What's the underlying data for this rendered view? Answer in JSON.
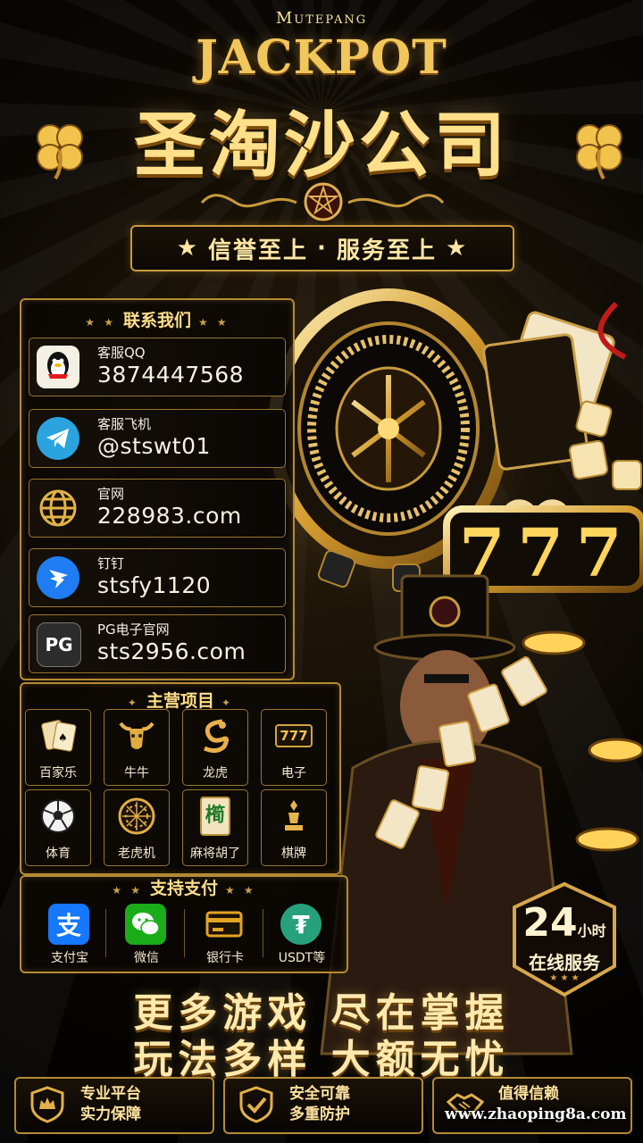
{
  "header": {
    "brand_small": "Mutepang",
    "jackpot": "JACKPOT",
    "title": "圣淘沙公司",
    "slogan_left": "信誉至上",
    "slogan_dot": "·",
    "slogan_right": "服务至上"
  },
  "contact": {
    "heading": "联系我们",
    "items": [
      {
        "label": "客服QQ",
        "value": "3874447568",
        "icon": "qq-penguin-icon"
      },
      {
        "label": "客服飞机",
        "value": "@stswt01",
        "icon": "telegram-icon"
      },
      {
        "label": "官网",
        "value": "228983.com",
        "icon": "globe-icon"
      },
      {
        "label": "钉钉",
        "value": "stsfy1120",
        "icon": "dingtalk-icon"
      },
      {
        "label": "PG电子官网",
        "value": "sts2956.com",
        "icon": "pg-logo-icon",
        "icon_text": "PG"
      }
    ]
  },
  "games": {
    "heading": "主营项目",
    "items": [
      {
        "label": "百家乐",
        "icon": "playing-cards-icon"
      },
      {
        "label": "牛牛",
        "icon": "bull-head-icon"
      },
      {
        "label": "龙虎",
        "icon": "dragon-icon"
      },
      {
        "label": "电子",
        "icon": "slot-777-icon",
        "icon_text": "777"
      },
      {
        "label": "体育",
        "icon": "soccer-ball-icon"
      },
      {
        "label": "老虎机",
        "icon": "roulette-wheel-icon"
      },
      {
        "label": "麻将胡了",
        "icon": "mahjong-tile-icon",
        "icon_text": "橁"
      },
      {
        "label": "棋牌",
        "icon": "chess-piece-icon"
      }
    ]
  },
  "payment": {
    "heading": "支持支付",
    "items": [
      {
        "label": "支付宝",
        "icon": "alipay-icon",
        "icon_text": "支",
        "color": "#1677ff"
      },
      {
        "label": "微信",
        "icon": "wechat-icon",
        "color": "#1aad19"
      },
      {
        "label": "银行卡",
        "icon": "bank-card-icon",
        "color": "#e2a423"
      },
      {
        "label": "USDT等",
        "icon": "tether-icon",
        "icon_text": "₮",
        "color": "#26a17b"
      }
    ]
  },
  "service_badge": {
    "big": "24",
    "small": "小时",
    "line2": "在线服务",
    "stars": "★ ★ ★"
  },
  "headline": {
    "line1": "更多游戏 尽在掌握",
    "line2": "玩法多样 大额无忧"
  },
  "features": [
    {
      "line1": "专业平台",
      "line2": "实力保障",
      "icon": "crown-shield-icon"
    },
    {
      "line1": "安全可靠",
      "line2": "多重防护",
      "icon": "check-shield-icon"
    },
    {
      "line1": "值得信赖",
      "line2": "",
      "icon": "handshake-icon"
    }
  ],
  "watermark": "www.zhaoping8a.com",
  "decor": {
    "slot_numbers": "777"
  }
}
